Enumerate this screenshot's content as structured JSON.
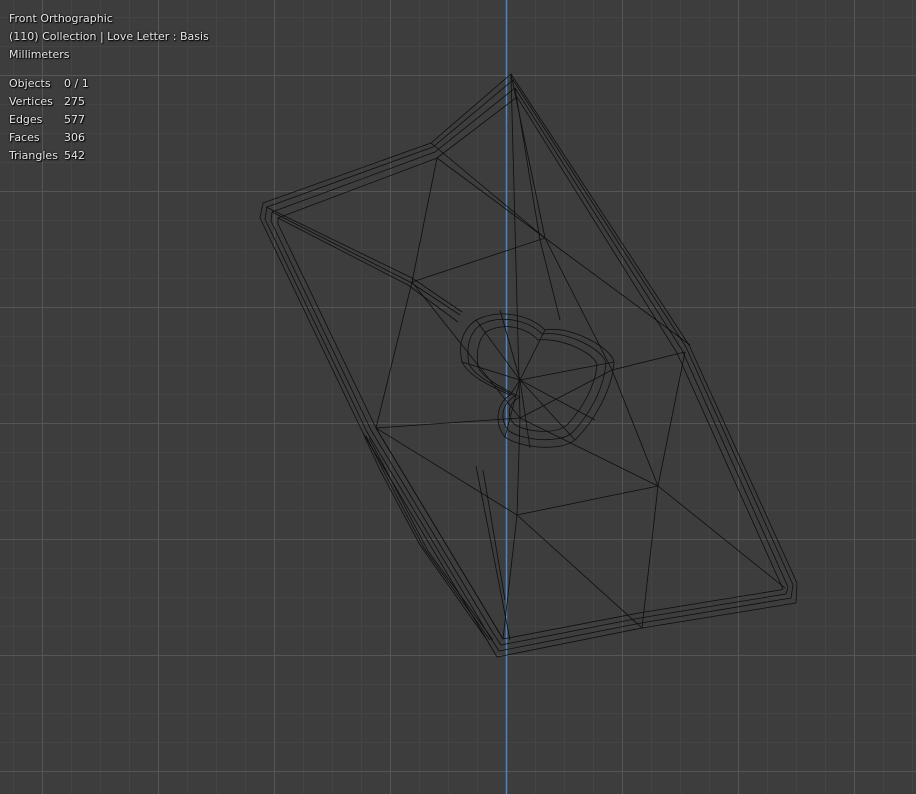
{
  "viewport": {
    "view_name": "Front Orthographic",
    "collection_info": "(110) Collection | Love Letter : Basis",
    "units": "Millimeters",
    "stats": [
      {
        "label": "Objects",
        "value": "0 / 1"
      },
      {
        "label": "Vertices",
        "value": "275"
      },
      {
        "label": "Edges",
        "value": "577"
      },
      {
        "label": "Faces",
        "value": "306"
      },
      {
        "label": "Triangles",
        "value": "542"
      }
    ]
  },
  "colors": {
    "background": "#3d3d3d",
    "grid_minor": "#454545",
    "grid_major": "#525252",
    "z_axis": "#4d86c4",
    "wireframe": "#0d0d0d"
  }
}
